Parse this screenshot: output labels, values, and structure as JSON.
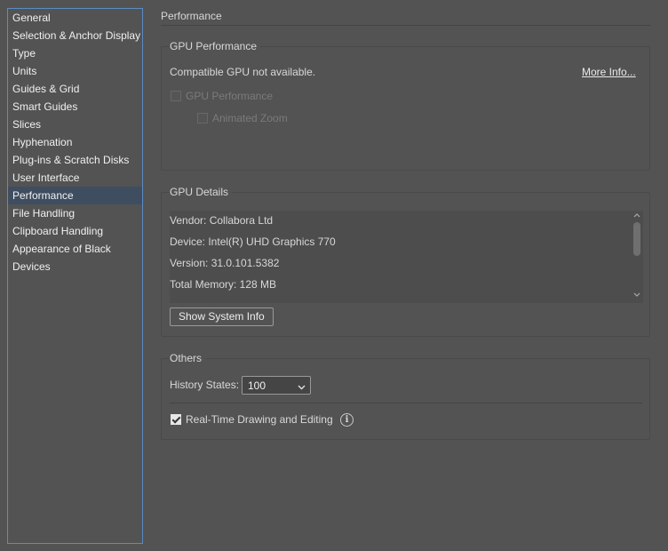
{
  "sidebar": {
    "items": [
      {
        "label": "General"
      },
      {
        "label": "Selection & Anchor Display"
      },
      {
        "label": "Type"
      },
      {
        "label": "Units"
      },
      {
        "label": "Guides & Grid"
      },
      {
        "label": "Smart Guides"
      },
      {
        "label": "Slices"
      },
      {
        "label": "Hyphenation"
      },
      {
        "label": "Plug-ins & Scratch Disks"
      },
      {
        "label": "User Interface"
      },
      {
        "label": "Performance",
        "selected": true
      },
      {
        "label": "File Handling"
      },
      {
        "label": "Clipboard Handling"
      },
      {
        "label": "Appearance of Black"
      },
      {
        "label": "Devices"
      }
    ]
  },
  "main": {
    "title": "Performance",
    "gpu_performance": {
      "title": "GPU Performance",
      "status": "Compatible GPU not available.",
      "more_info": "More Info...",
      "gpu_checkbox_label": "GPU Performance",
      "animated_zoom_label": "Animated Zoom"
    },
    "gpu_details": {
      "title": "GPU Details",
      "lines": [
        "Vendor: Collabora Ltd",
        "Device: Intel(R) UHD Graphics 770",
        "Version: 31.0.101.5382",
        "Total Memory: 128 MB"
      ],
      "show_system_info": "Show System Info"
    },
    "others": {
      "title": "Others",
      "history_states_label": "History States:",
      "history_states_value": "100",
      "realtime_label": "Real-Time Drawing and Editing",
      "realtime_checked": true
    }
  },
  "icons": {
    "info": "info-icon",
    "chevron": "chevron-down-icon"
  },
  "colors": {
    "background": "#535353",
    "selection": "#3f4d61",
    "sidebar_border": "#5b8bc4"
  }
}
